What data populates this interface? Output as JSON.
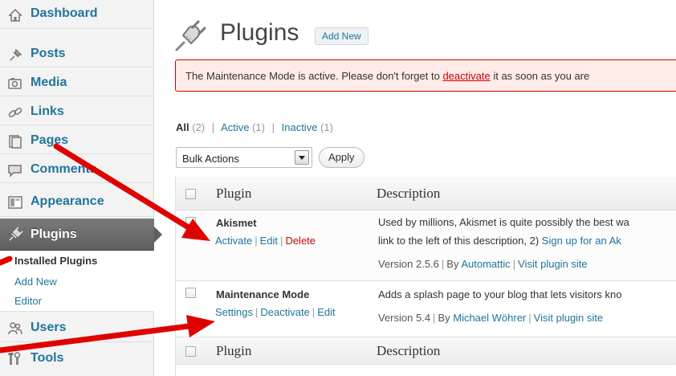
{
  "sidebar": {
    "items": [
      {
        "id": "dashboard",
        "label": "Dashboard",
        "icon": "dashboard-icon"
      },
      {
        "id": "posts",
        "label": "Posts",
        "icon": "pin-icon"
      },
      {
        "id": "media",
        "label": "Media",
        "icon": "media-icon"
      },
      {
        "id": "links",
        "label": "Links",
        "icon": "links-icon"
      },
      {
        "id": "pages",
        "label": "Pages",
        "icon": "pages-icon"
      },
      {
        "id": "comments",
        "label": "Comments",
        "icon": "comments-icon"
      },
      {
        "id": "appearance",
        "label": "Appearance",
        "icon": "appearance-icon"
      },
      {
        "id": "plugins",
        "label": "Plugins",
        "icon": "plug-icon",
        "current": true
      },
      {
        "id": "users",
        "label": "Users",
        "icon": "users-icon"
      },
      {
        "id": "tools",
        "label": "Tools",
        "icon": "tools-icon"
      }
    ],
    "submenu": [
      {
        "label": "Installed Plugins",
        "current": true
      },
      {
        "label": "Add New"
      },
      {
        "label": "Editor"
      }
    ]
  },
  "header": {
    "title": "Plugins",
    "add_new_label": "Add New"
  },
  "notice": {
    "before": "The Maintenance Mode is active. Please don't forget to ",
    "link": "deactivate",
    "after": " it as soon as you are"
  },
  "filters": {
    "all_label": "All",
    "all_count": "(2)",
    "active_label": "Active",
    "active_count": "(1)",
    "inactive_label": "Inactive",
    "inactive_count": "(1)",
    "separator": "|"
  },
  "bulk": {
    "selected": "Bulk Actions",
    "apply_label": "Apply"
  },
  "table": {
    "col_plugin": "Plugin",
    "col_description": "Description",
    "rows": [
      {
        "name": "Akismet",
        "actions": [
          "Activate",
          "Edit",
          "Delete"
        ],
        "desc_line1": "Used by millions, Akismet is quite possibly the best wa",
        "desc_line2_before": "link to the left of this description, 2) ",
        "desc_line2_link": "Sign up for an Ak",
        "version": "Version 2.5.6",
        "by_prefix": "By ",
        "author": "Automattic",
        "site_link": "Visit plugin site"
      },
      {
        "name": "Maintenance Mode",
        "actions": [
          "Settings",
          "Deactivate",
          "Edit"
        ],
        "desc_line1": "Adds a splash page to your blog that lets visitors kno",
        "version": "Version 5.4",
        "by_prefix": "By ",
        "author": "Michael Wöhrer",
        "site_link": "Visit plugin site"
      }
    ],
    "separator": "|"
  },
  "colors": {
    "link": "#21759b",
    "notice_border": "#cc0000",
    "notice_bg": "#ffebe8",
    "delete": "#bc0b0b",
    "arrow": "#e00000"
  }
}
